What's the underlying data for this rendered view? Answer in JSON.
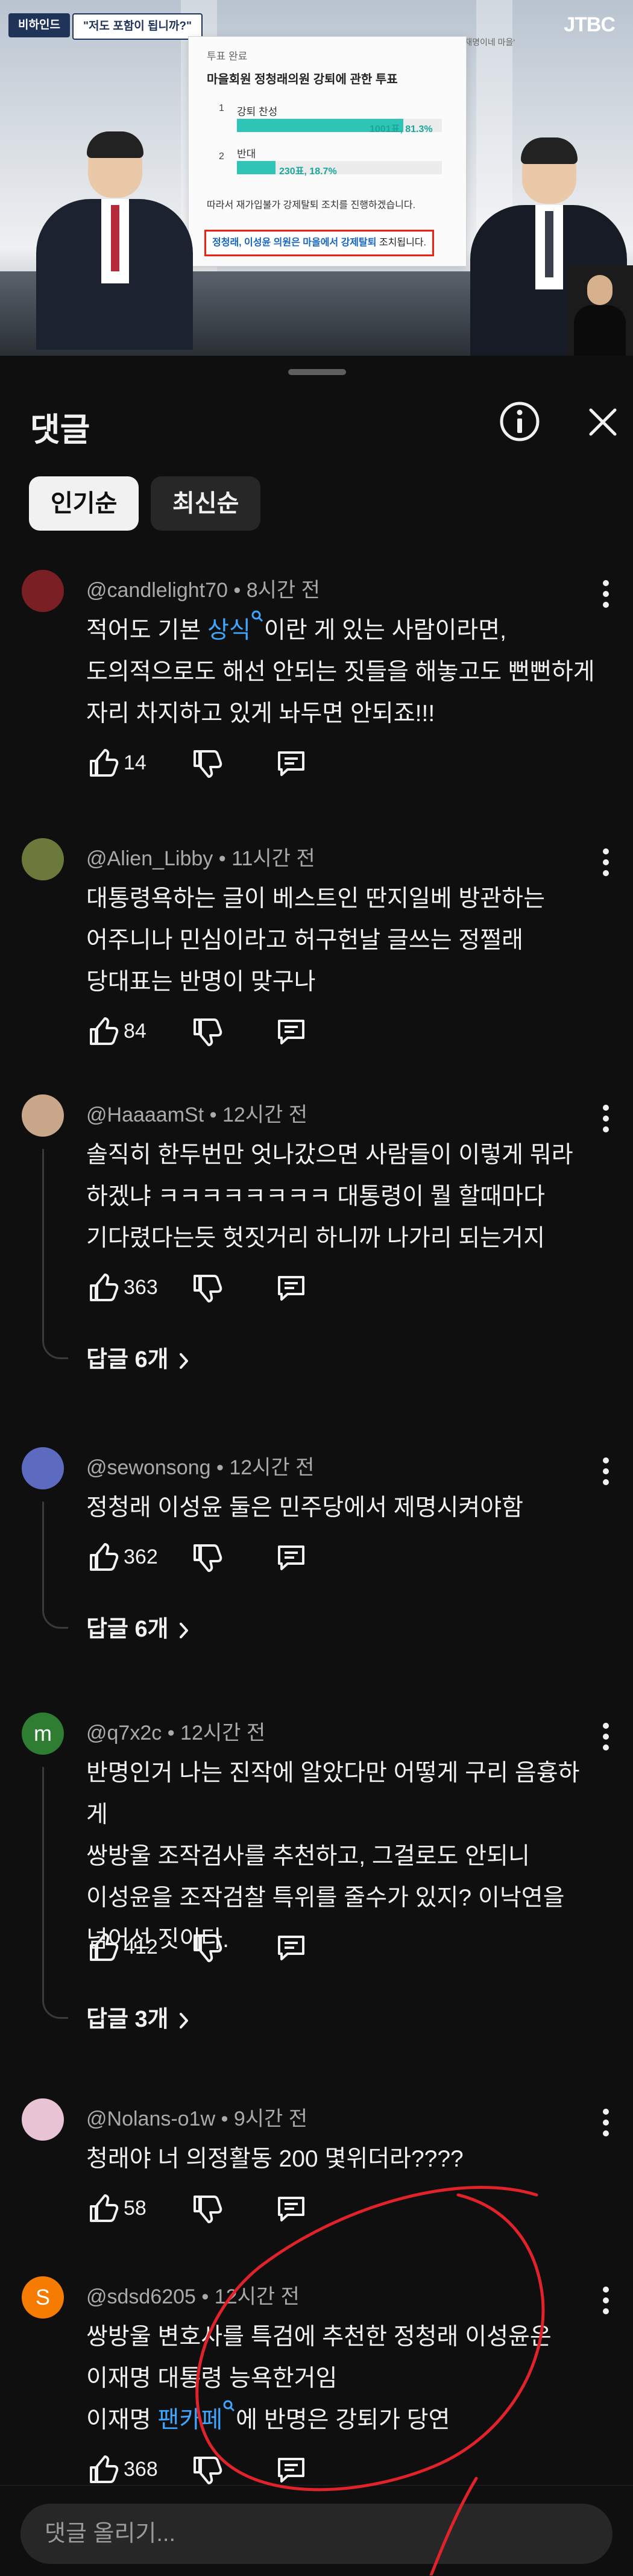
{
  "video": {
    "tag_primary": "비하인드",
    "tag_secondary": "\"저도 포함이 됩니까?\"",
    "logo": "JTBC",
    "caption": "화면출처 네이버 카페 '재명이네 마을'",
    "poll": {
      "status": "투표 완료",
      "title": "마을회원 정청래의원 강퇴에 관한 투표",
      "options": [
        {
          "num": "1",
          "label": "강퇴 찬성",
          "value": "1001표, 81.3%",
          "share": 0.813
        },
        {
          "num": "2",
          "label": "반대",
          "value": "230표, 18.7%",
          "share": 0.187
        }
      ],
      "note": "따라서 재가입불가 강제탈퇴 조치를 진행하겠습니다.",
      "box_text_highlight": "정청래, 이성윤 의원은 마을에서 강제탈퇴",
      "box_text_rest": " 조치됩니다."
    }
  },
  "sheet": {
    "title": "댓글",
    "filters": [
      {
        "label": "인기순"
      },
      {
        "label": "최신순"
      }
    ],
    "input_placeholder": "댓글 올리기..."
  },
  "comments": [
    {
      "author": "@candlelight70",
      "time": "8시간 전",
      "text_before": "적어도 기본 ",
      "link": "상식",
      "text_after": "이란 게 있는 사람이라면,\n도의적으로도 해선 안되는 짓들을 해놓고도 뻔뻔하게\n자리 차지하고 있게 놔두면 안되죠!!!",
      "likes": "14",
      "avatar_color": "#7a1f24"
    },
    {
      "author": "@Alien_Libby",
      "time": "11시간 전",
      "text": "대통령욕하는 글이 베스트인 딴지일베 방관하는\n어주니나  민심이라고 허구헌날 글쓰는 정쩔래\n당대표는 반명이 맞구나",
      "likes": "84",
      "avatar_color": "#6b7a3a"
    },
    {
      "author": "@HaaaamSt",
      "time": "12시간 전",
      "text": "솔직히 한두번만 엇나갔으면 사람들이 이렇게 뭐라\n하겠냐 ㅋㅋㅋㅋㅋㅋㅋㅋ 대통령이 뭘 할때마다\n기다렸다는듯 헛짓거리 하니까 나가리 되는거지",
      "likes": "363",
      "replies": "답글 6개",
      "avatar_color": "#c9a78a"
    },
    {
      "author": "@sewonsong",
      "time": "12시간 전",
      "text": "정청래 이성윤 둘은 민주당에서 제명시켜야함",
      "likes": "362",
      "replies": "답글 6개",
      "avatar_color": "#5c6bc0"
    },
    {
      "author": "@q7x2c",
      "time": "12시간 전",
      "avatar_letter": "m",
      "text": "반명인거 나는 진작에 알았다만 어떻게 구리 음흉하게\n쌍방울 조작검사를 추천하고, 그걸로도 안되니\n이성윤을 조작검찰 특위를 줄수가 있지? 이낙연을\n넘어선 짓이다.",
      "likes": "412",
      "replies": "답글 3개",
      "avatar_color": "#2e7d32"
    },
    {
      "author": "@Nolans-o1w",
      "time": "9시간 전",
      "text": "청래야 너 의정활동 200 몇위더라????",
      "likes": "58",
      "avatar_color": "#e8c3d3"
    },
    {
      "author": "@sdsd6205",
      "time": "12시간 전",
      "avatar_letter": "S",
      "text_before": "쌍방울 변호사를 특검에 추천한 정청래 이성윤은\n이재명 대통령 능욕한거임\n이재명 ",
      "link": "팬카페",
      "text_after": "에 반명은 강퇴가 당연",
      "likes": "368",
      "avatar_color": "#f57c00"
    }
  ]
}
